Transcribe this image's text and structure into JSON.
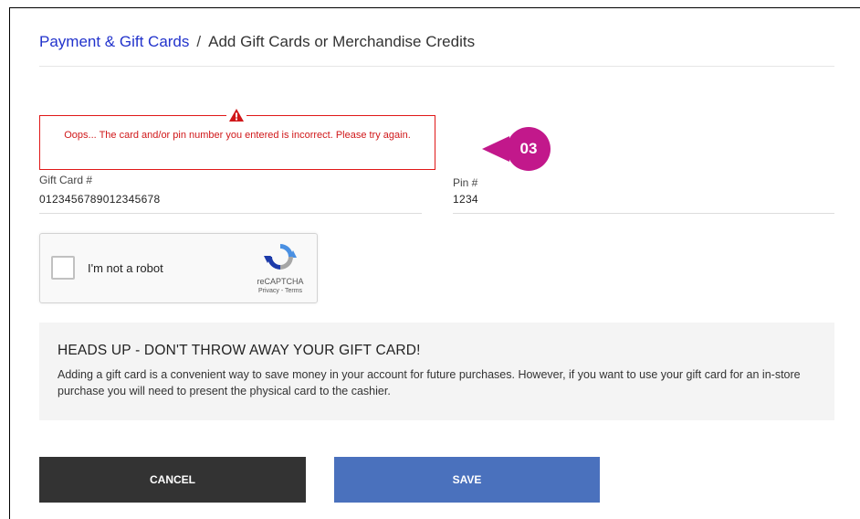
{
  "breadcrumb": {
    "parent": "Payment & Gift Cards",
    "separator": "/",
    "current": "Add Gift Cards or Merchandise Credits"
  },
  "error": {
    "icon": "warning-triangle-icon",
    "message": "Oops... The card and/or pin number you entered is incorrect. Please try again.",
    "color": "#d0181a"
  },
  "callout": {
    "label": "03",
    "color": "#c2188b"
  },
  "form": {
    "gift_card": {
      "label": "Gift Card #",
      "value": "0123456789012345678"
    },
    "pin": {
      "label": "Pin #",
      "value": "1234"
    }
  },
  "captcha": {
    "label": "I'm not a robot",
    "brand": "reCAPTCHA",
    "links": "Privacy - Terms",
    "icon": "recaptcha-logo-icon"
  },
  "notice": {
    "title": "HEADS UP - DON'T THROW AWAY YOUR GIFT CARD!",
    "body": "Adding a gift card is a convenient way to save money in your account for future purchases. However, if you want to use your gift card for an in-store purchase you will need to present the physical card to the cashier."
  },
  "buttons": {
    "cancel": "CANCEL",
    "save": "SAVE"
  },
  "colors": {
    "link": "#2233cc",
    "cancel_bg": "#333333",
    "save_bg": "#4a71bd"
  }
}
